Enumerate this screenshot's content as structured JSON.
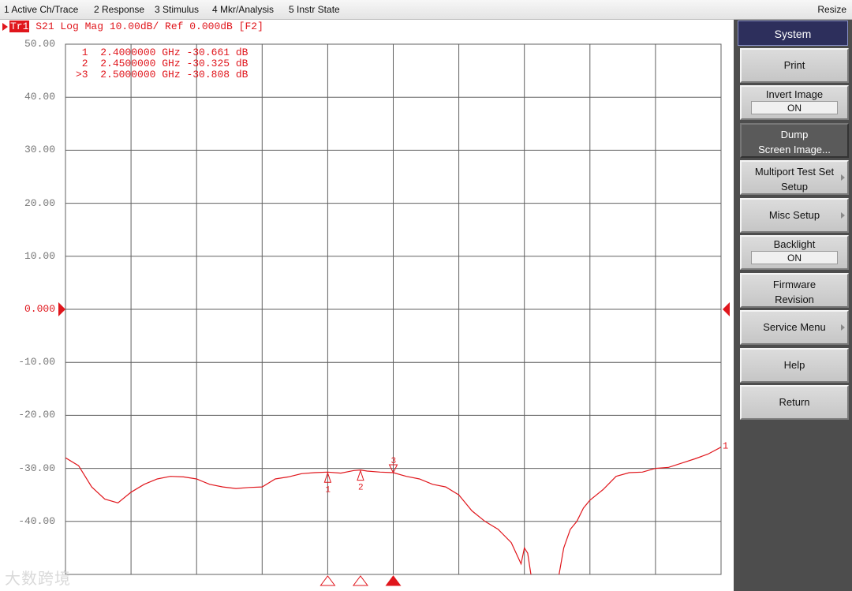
{
  "menubar": {
    "items": [
      "1 Active Ch/Trace",
      "2 Response",
      "3 Stimulus",
      "4 Mkr/Analysis",
      "5 Instr State"
    ],
    "resize": "Resize"
  },
  "trace": {
    "tag": "Tr1",
    "header": "S21 Log Mag 10.00dB/ Ref 0.000dB [F2]"
  },
  "markers": [
    {
      "label": " 1",
      "freq": "2.4000000 GHz",
      "value": "-30.661 dB"
    },
    {
      "label": " 2",
      "freq": "2.4500000 GHz",
      "value": "-30.325 dB"
    },
    {
      "label": ">3",
      "freq": "2.5000000 GHz",
      "value": "-30.808 dB"
    }
  ],
  "yaxis": {
    "ticks": [
      "50.00",
      "40.00",
      "30.00",
      "20.00",
      "10.00",
      "0.000",
      "-10.00",
      "-20.00",
      "-30.00",
      "-40.00"
    ],
    "reference": "0.000"
  },
  "trace_end_label": "1",
  "watermark": "大数跨境",
  "colors": {
    "trace": "#e0161c",
    "grid": "#606060",
    "panel": "#4d4d4d",
    "panel_title": "#2d2f5c"
  },
  "chart_data": {
    "type": "line",
    "title": "S21 Log Mag 10.00dB/ Ref 0.000dB [F2]",
    "ylim": [
      -50,
      50
    ],
    "xlim": [
      0,
      10
    ],
    "grid": true,
    "marker_positions": [
      4,
      4.5,
      5
    ],
    "series": [
      {
        "x": [
          0,
          0.2,
          0.4,
          0.6,
          0.8,
          1.0,
          1.2,
          1.4,
          1.6,
          1.8,
          2.0,
          2.2,
          2.4,
          2.6,
          2.8,
          3.0,
          3.2,
          3.4,
          3.6,
          3.8,
          4.0,
          4.2,
          4.4,
          4.5,
          4.6,
          4.8,
          5.0,
          5.2,
          5.4,
          5.6,
          5.8,
          6.0,
          6.2,
          6.4,
          6.6,
          6.8,
          6.95,
          7.0,
          7.05,
          7.1,
          7.2,
          7.3,
          7.4,
          7.5,
          7.6,
          7.7,
          7.8,
          7.9,
          8.0,
          8.2,
          8.4,
          8.6,
          8.8,
          9.0,
          9.2,
          9.4,
          9.6,
          9.8,
          10.0
        ],
        "y": [
          -28,
          -29.5,
          -33.5,
          -35.8,
          -36.5,
          -34.5,
          -33,
          -32,
          -31.5,
          -31.6,
          -32,
          -33,
          -33.5,
          -33.8,
          -33.6,
          -33.5,
          -32,
          -31.6,
          -31,
          -30.8,
          -30.7,
          -30.9,
          -30.4,
          -30.3,
          -30.5,
          -30.7,
          -30.8,
          -31.5,
          -32,
          -33,
          -33.5,
          -35,
          -38,
          -40,
          -41.5,
          -44,
          -48,
          -45,
          -46,
          -50,
          -53.5,
          -54,
          -54.5,
          -52,
          -45,
          -41.5,
          -40,
          -37.5,
          -36,
          -34,
          -31.5,
          -30.8,
          -30.7,
          -30,
          -29.8,
          -29,
          -28.2,
          -27.3,
          -26
        ]
      }
    ]
  },
  "panel": {
    "title": "System",
    "keys": [
      {
        "label": "Print"
      },
      {
        "label": "Invert Image",
        "state": "ON"
      },
      {
        "label": "Dump",
        "label2": "Screen Image..."
      },
      {
        "label": "Multiport Test Set",
        "label2": "Setup"
      },
      {
        "label": "Misc Setup"
      },
      {
        "label": "Backlight",
        "state": "ON"
      },
      {
        "label": "Firmware",
        "label2": "Revision"
      },
      {
        "label": "Service Menu"
      },
      {
        "label": "Help"
      },
      {
        "label": "Return"
      }
    ]
  }
}
